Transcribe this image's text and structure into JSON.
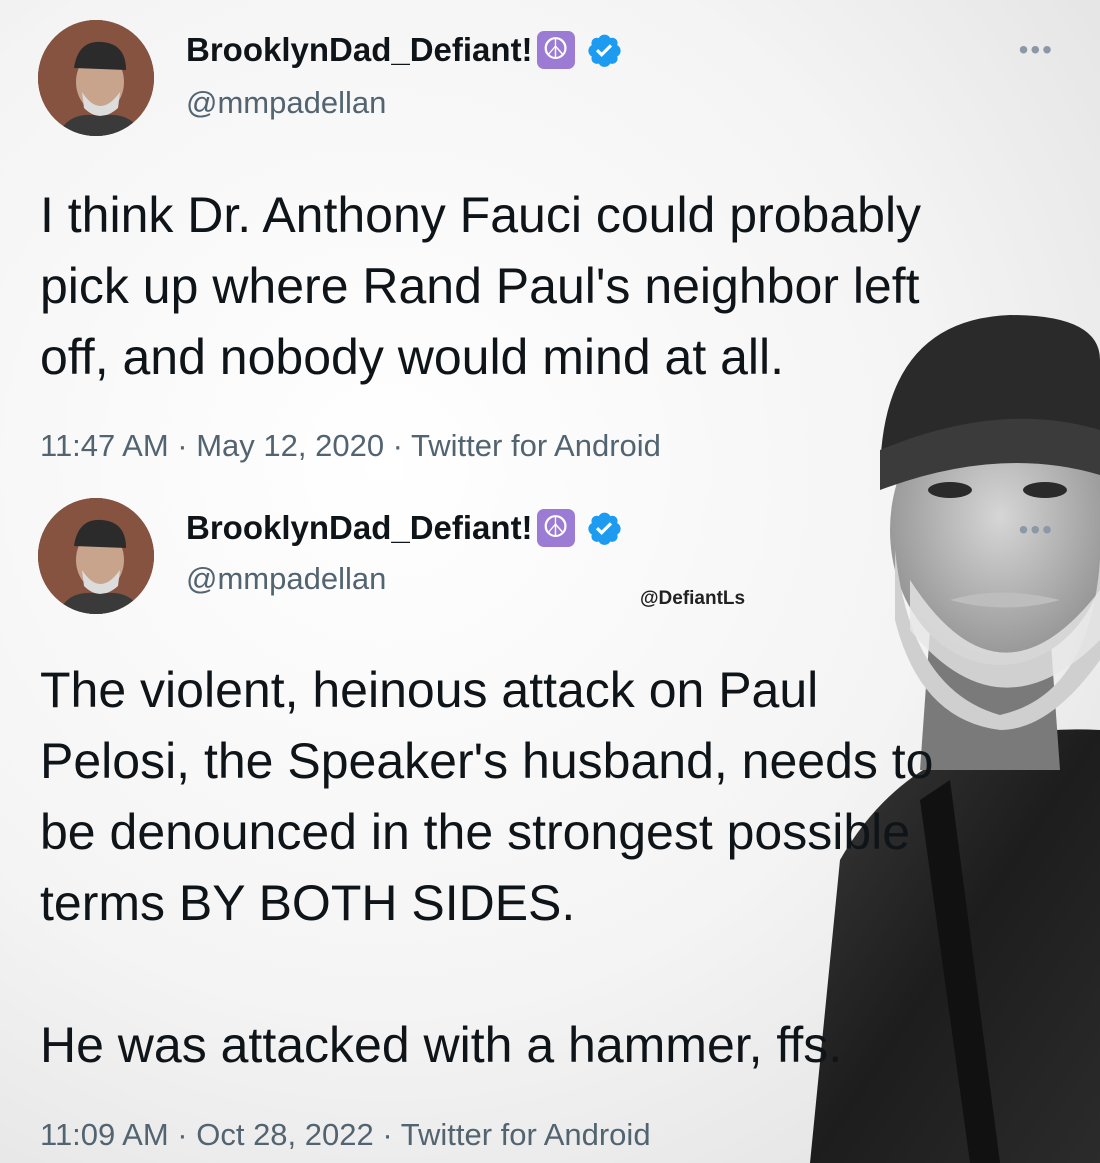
{
  "tweets": [
    {
      "display_name": "BrooklynDad_Defiant!",
      "peace_symbol": "☮",
      "handle": "@mmpadellan",
      "more": "•••",
      "text": "I think Dr. Anthony Fauci could probably\npick up where Rand Paul's neighbor left\noff, and nobody would mind at all.",
      "meta": "11:47 AM · May 12, 2020 · Twitter for Android"
    },
    {
      "display_name": "BrooklynDad_Defiant!",
      "peace_symbol": "☮",
      "handle": "@mmpadellan",
      "more": "•••",
      "text": "The violent, heinous attack on Paul\nPelosi, the Speaker's husband, needs to\nbe denounced in the strongest possible\nterms BY BOTH SIDES.\n\nHe was attacked with a hammer, ffs.",
      "meta": "11:09 AM · Oct 28, 2022 · Twitter for Android"
    }
  ],
  "watermark": "@DefiantLs",
  "colors": {
    "verified": "#1d9bf0",
    "peace_badge": "#9b7bd3",
    "secondary_text": "#536471"
  }
}
